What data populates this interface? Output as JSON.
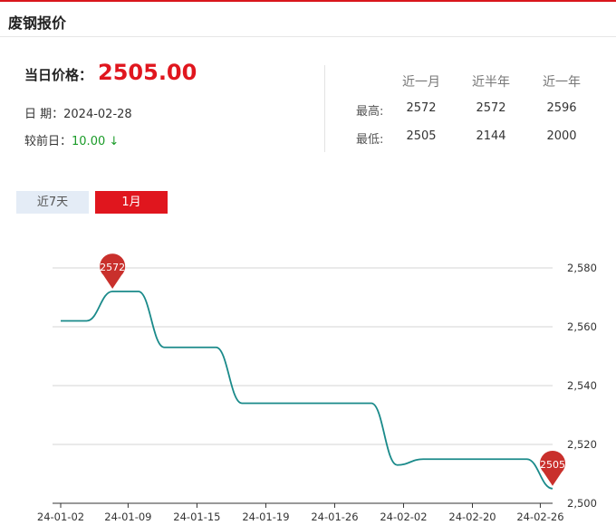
{
  "header": {
    "title": "废钢报价"
  },
  "price": {
    "label": "当日价格：",
    "value": "2505.00",
    "date_label": "日 期：",
    "date": "2024-02-28",
    "delta_label": "较前日：",
    "delta": "10.00 ↓",
    "delta_color": "#1a9b28",
    "price_color": "#e0161e"
  },
  "stats": {
    "columns": [
      "近一月",
      "近半年",
      "近一年"
    ],
    "rows": [
      {
        "label": "最高:",
        "values": [
          "2572",
          "2572",
          "2596"
        ]
      },
      {
        "label": "最低:",
        "values": [
          "2505",
          "2144",
          "2000"
        ]
      }
    ]
  },
  "tabs": [
    {
      "label": "近7天",
      "active": false
    },
    {
      "label": "1月",
      "active": true
    }
  ],
  "chart_data": {
    "type": "line",
    "x_tick_labels": [
      "24-01-02",
      "24-01-09",
      "24-01-15",
      "24-01-19",
      "24-01-26",
      "24-02-02",
      "24-02-20",
      "24-02-26"
    ],
    "y_tick_labels": [
      "2,500",
      "2,520",
      "2,540",
      "2,560",
      "2,580"
    ],
    "ylim": [
      2500,
      2580
    ],
    "y_axis_position": "right",
    "grid": true,
    "series": [
      {
        "color": "#1a8a8a",
        "points": [
          {
            "i": 0,
            "y": 2562
          },
          {
            "i": 1,
            "y": 2562
          },
          {
            "i": 2,
            "y": 2572
          },
          {
            "i": 3,
            "y": 2572
          },
          {
            "i": 4,
            "y": 2553
          },
          {
            "i": 5,
            "y": 2553
          },
          {
            "i": 6,
            "y": 2553
          },
          {
            "i": 7,
            "y": 2534
          },
          {
            "i": 8,
            "y": 2534
          },
          {
            "i": 9,
            "y": 2534
          },
          {
            "i": 10,
            "y": 2534
          },
          {
            "i": 11,
            "y": 2534
          },
          {
            "i": 12,
            "y": 2534
          },
          {
            "i": 13,
            "y": 2513
          },
          {
            "i": 14,
            "y": 2515
          },
          {
            "i": 15,
            "y": 2515
          },
          {
            "i": 16,
            "y": 2515
          },
          {
            "i": 17,
            "y": 2515
          },
          {
            "i": 18,
            "y": 2515
          },
          {
            "i": 19,
            "y": 2505
          }
        ]
      }
    ],
    "markers": [
      {
        "label": "2572",
        "i": 2,
        "y": 2572,
        "color": "#c9302c"
      },
      {
        "label": "2505",
        "i": 19,
        "y": 2505,
        "color": "#c9302c"
      }
    ]
  }
}
